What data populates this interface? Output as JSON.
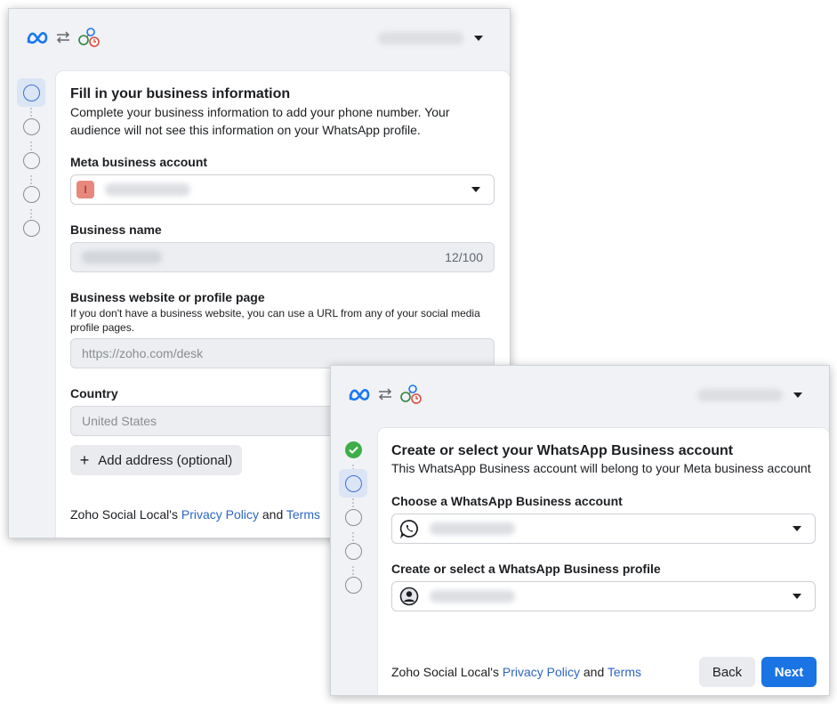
{
  "window1": {
    "panel": {
      "title": "Fill in your business information",
      "subtitle": "Complete your business information to add your phone number. Your audience will not see this information on your WhatsApp profile.",
      "meta_account_label": "Meta business account",
      "meta_account_avatar_letter": "I",
      "business_name_label": "Business name",
      "business_name_counter": "12/100",
      "website_label": "Business website or profile page",
      "website_help": "If you don't have a business website, you can use a URL from any of your social media profile pages.",
      "website_placeholder": "https://zoho.com/desk",
      "country_label": "Country",
      "country_value": "United States",
      "add_address_label": "Add address (optional)",
      "footer_prefix": "Zoho Social Local's",
      "footer_privacy": "Privacy Policy",
      "footer_and": "and",
      "footer_terms": "Terms"
    }
  },
  "window2": {
    "panel": {
      "title": "Create or select your WhatsApp Business account",
      "subtitle": "This WhatsApp Business account will belong to your Meta business account",
      "account_label": "Choose a WhatsApp Business account",
      "profile_label": "Create or select a WhatsApp Business profile",
      "footer_prefix": "Zoho Social Local's",
      "footer_privacy": "Privacy Policy",
      "footer_and": "and",
      "footer_terms": "Terms",
      "back_label": "Back",
      "next_label": "Next"
    }
  },
  "colors": {
    "accent": "#1b74e4",
    "link": "#2d65c7",
    "step_active": "#3b73d6",
    "step_done": "#3fae49"
  },
  "icons": [
    "meta-logo-icon",
    "swap-arrows-icon",
    "business-apps-icon",
    "chevron-down-icon",
    "whatsapp-icon",
    "profile-icon",
    "check-icon",
    "plus-icon"
  ]
}
